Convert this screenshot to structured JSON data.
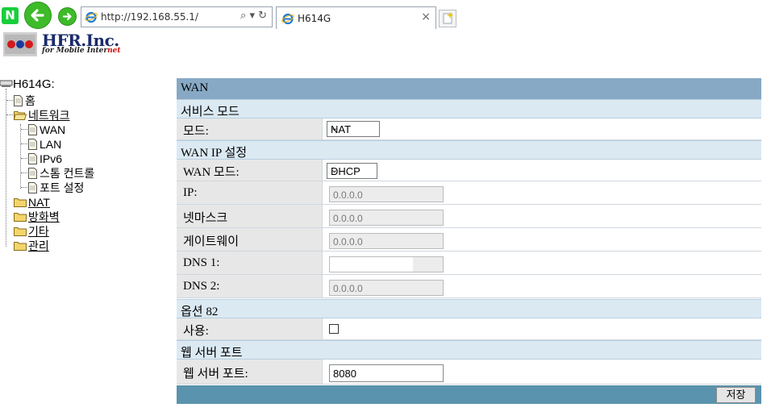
{
  "browser": {
    "url": "http://192.168.55.1/",
    "tab_title": "H614G",
    "search_tools": "⌕ ▾ ↻",
    "close_glyph": "×"
  },
  "brand": {
    "name": "HFR.Inc.",
    "tagline_prefix": "for Mobile Inter",
    "tagline_suffix": "net"
  },
  "tree": {
    "root": "H614G:",
    "items": [
      {
        "label": "홈"
      },
      {
        "label": "네트워크"
      },
      {
        "label": "WAN"
      },
      {
        "label": "LAN"
      },
      {
        "label": "IPv6"
      },
      {
        "label": "스톰 컨트롤"
      },
      {
        "label": "포트 설정"
      },
      {
        "label": "NAT"
      },
      {
        "label": "방화벽"
      },
      {
        "label": "기타"
      },
      {
        "label": "관리"
      }
    ]
  },
  "form": {
    "title": "WAN",
    "service_section": "서비스 모드",
    "mode_label": "모드:",
    "mode_value": "NAT",
    "wanip_section": "WAN IP 설정",
    "wan_mode_label": "WAN 모드:",
    "wan_mode_value": "DHCP",
    "ip_label": "IP:",
    "ip_value": "0.0.0.0",
    "netmask_label": "넷마스크",
    "netmask_value": "0.0.0.0",
    "gateway_label": "게이트웨이",
    "gateway_value": "0.0.0.0",
    "dns1_label": "DNS 1:",
    "dns1_value": "",
    "dns2_label": "DNS 2:",
    "dns2_value": "0.0.0.0",
    "option82_section": "옵션 82",
    "use_label": "사용:",
    "use_checked": false,
    "webport_section": "웹 서버 포트",
    "webport_label": "웹 서버 포트:",
    "webport_value": "8080",
    "save_label": "저장"
  },
  "colors": {
    "title_bar": "#87a9c5",
    "section_bg": "#dbe9f3",
    "label_bg": "#e7e7e7",
    "bottom_bar": "#5a93ad"
  }
}
